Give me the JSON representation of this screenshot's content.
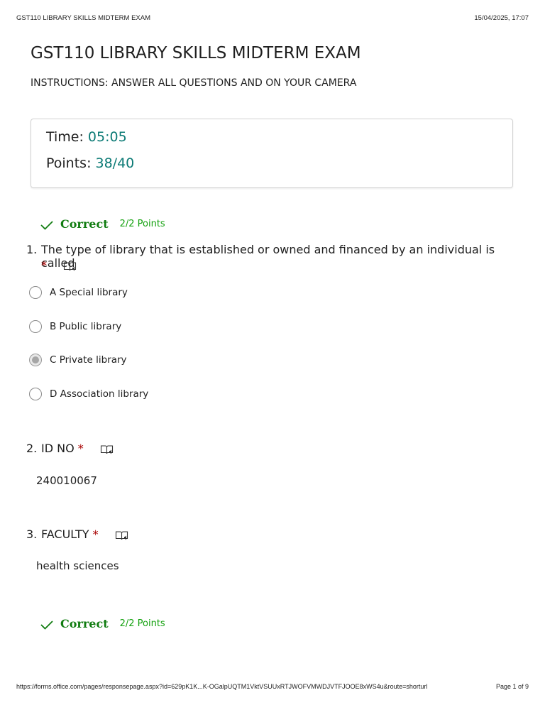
{
  "print_header": {
    "title": "GST110 LIBRARY SKILLS MIDTERM EXAM",
    "datetime": "15/04/2025, 17:07"
  },
  "form": {
    "title": "GST110 LIBRARY SKILLS MIDTERM EXAM",
    "description": "INSTRUCTIONS: ANSWER ALL QUESTIONS AND ON YOUR CAMERA"
  },
  "score": {
    "time_label": "Time:",
    "time_value": "05:05",
    "points_label": "Points:",
    "points_value": "38/40"
  },
  "questions": [
    {
      "status": "Correct",
      "points": "2/2 Points",
      "number": "1.",
      "text": "The type of library that is established or owned and financed by an individual is called",
      "required_mark": "*",
      "options": [
        {
          "label": "A Special library",
          "selected": false
        },
        {
          "label": "B Public library",
          "selected": false
        },
        {
          "label": "C Private library",
          "selected": true
        },
        {
          "label": "D Association library",
          "selected": false
        }
      ]
    },
    {
      "number": "2.",
      "text": "ID NO",
      "required_mark": "*",
      "answer": "240010067"
    },
    {
      "number": "3.",
      "text": "FACULTY",
      "required_mark": "*",
      "answer": "health sciences"
    },
    {
      "status": "Correct",
      "points": "2/2 Points"
    }
  ],
  "icons": {
    "status_icon": "check-icon",
    "reader_icon": "immersive-reader-icon"
  },
  "colors": {
    "correct": "#107c10",
    "points": "#13a10e",
    "score_value": "#0b7a75",
    "required": "#a80000"
  },
  "print_footer": {
    "url": "https://forms.office.com/pages/responsepage.aspx?id=629pK1K...K-OGalpUQTM1VktVSUUxRTJWOFVMWDJVTFJOOE8xWS4u&route=shorturl",
    "page": "Page 1 of 9"
  }
}
